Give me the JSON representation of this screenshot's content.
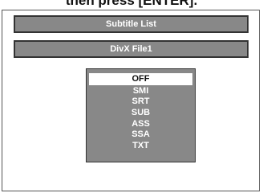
{
  "instruction": "then press [ENTER].",
  "panel": {
    "title": "Subtitle List",
    "file_name": "DivX File1"
  },
  "menu": {
    "selected_index": 0,
    "items": [
      "OFF",
      "SMI",
      "SRT",
      "SUB",
      "ASS",
      "SSA",
      "TXT"
    ]
  }
}
